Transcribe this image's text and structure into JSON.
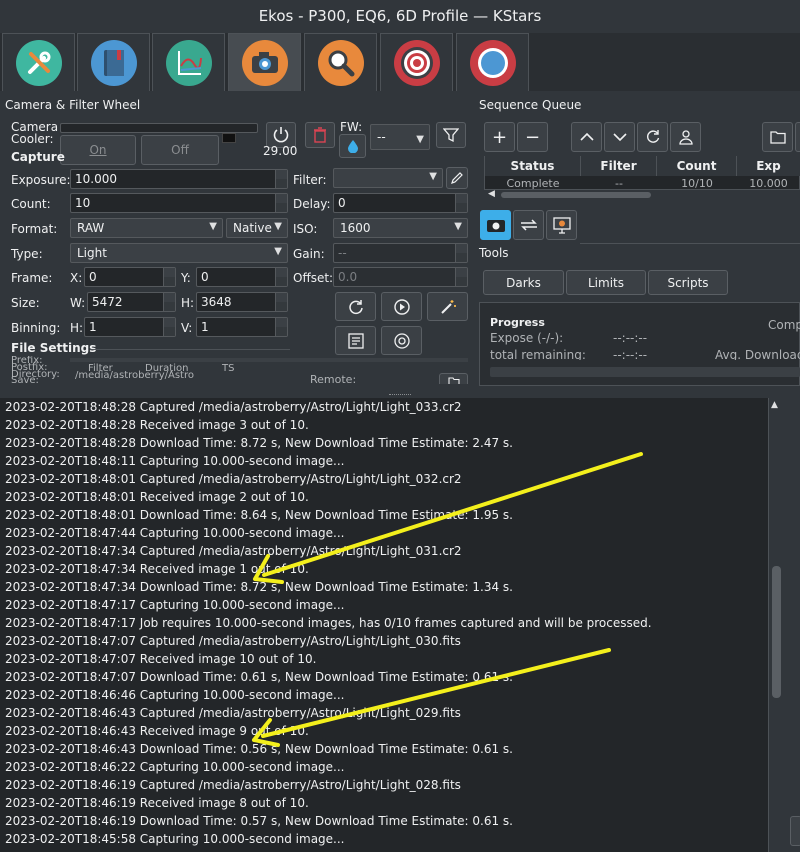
{
  "window": {
    "title": "Ekos - P300, EQ6, 6D Profile — KStars"
  },
  "tabs": [
    {
      "name": "setup-tools-icon",
      "color": "#3fb7a0"
    },
    {
      "name": "scheduler-book-icon",
      "color": "#4c97d3"
    },
    {
      "name": "analyze-chart-icon",
      "color": "#39a88f"
    },
    {
      "name": "capture-camera-icon",
      "color": "#e8893c"
    },
    {
      "name": "focus-magnifier-icon",
      "color": "#e8893c"
    },
    {
      "name": "align-target-icon",
      "color": "#c93d44"
    },
    {
      "name": "guide-compass-icon",
      "color": "#c93d44"
    }
  ],
  "camera": {
    "panel_title": "Camera & Filter Wheel",
    "cooler_label": "Camera\nCooler:",
    "on_label": "On",
    "off_label": "Off",
    "temperature": "29.00",
    "fw_label": "FW:",
    "fw_value": "--",
    "capture_label": "Capture",
    "exposure_label": "Exposure:",
    "exposure_value": "10.000",
    "count_label": "Count:",
    "count_value": "10",
    "format_label": "Format:",
    "format_value": "RAW",
    "native_value": "Native",
    "type_label": "Type:",
    "type_value": "Light",
    "frame_label": "Frame:",
    "x_label": "X:",
    "x_value": "0",
    "y_label": "Y:",
    "y_value": "0",
    "size_label": "Size:",
    "w_label": "W:",
    "w_value": "5472",
    "h_label": "H:",
    "h_value": "3648",
    "binning_label": "Binning:",
    "hbin_label": "H:",
    "hbin_value": "1",
    "vbin_label": "V:",
    "vbin_value": "1",
    "filter_label": "Filter:",
    "filter_value": "",
    "delay_label": "Delay:",
    "delay_value": "0",
    "iso_label": "ISO:",
    "iso_value": "1600",
    "gain_label": "Gain:",
    "gain_value": "--",
    "offset_label": "Offset:",
    "offset_value": "0.0",
    "file_settings_label": "File Settings",
    "prefix_label": "Prefix:",
    "postfix_label": "Postfix:",
    "directory_label": "Directory:",
    "save_label": "Save:",
    "filter_chip": "Filter",
    "duration_chip": "Duration",
    "ts_chip": "TS",
    "directory_value": "/media/astroberry/Astro",
    "remote_label": "Remote:"
  },
  "sequence": {
    "panel_title": "Sequence Queue",
    "columns": [
      "Status",
      "Filter",
      "Count",
      "Exp"
    ],
    "rows": [
      [
        "Complete",
        "--",
        "10/10",
        "10.000"
      ]
    ],
    "tools_label": "Tools",
    "darks_label": "Darks",
    "limits_label": "Limits",
    "scripts_label": "Scripts",
    "progress_label": "Progress",
    "expose_label": "Expose (-/-):",
    "expose_value": "--:--:--",
    "total_label": "total remaining:",
    "total_value": "--:--:--",
    "comp_label": "Comp",
    "avg_download_label": "Avg. Download"
  },
  "log": [
    "2023-02-20T18:48:28 Captured /media/astroberry/Astro/Light/Light_033.cr2",
    "2023-02-20T18:48:28 Received image 3 out of 10.",
    "2023-02-20T18:48:28 Download Time: 8.72 s, New Download Time Estimate: 2.47 s.",
    "2023-02-20T18:48:11 Capturing 10.000-second  image...",
    "2023-02-20T18:48:01 Captured /media/astroberry/Astro/Light/Light_032.cr2",
    "2023-02-20T18:48:01 Received image 2 out of 10.",
    "2023-02-20T18:48:01 Download Time: 8.64 s, New Download Time Estimate: 1.95 s.",
    "2023-02-20T18:47:44 Capturing 10.000-second  image...",
    "2023-02-20T18:47:34 Captured /media/astroberry/Astro/Light/Light_031.cr2",
    "2023-02-20T18:47:34 Received image 1 out of 10.",
    "2023-02-20T18:47:34 Download Time: 8.72 s, New Download Time Estimate: 1.34 s.",
    "2023-02-20T18:47:17 Capturing 10.000-second  image...",
    "2023-02-20T18:47:17 Job requires 10.000-second  images, has 0/10 frames captured and will be processed.",
    "2023-02-20T18:47:07 Captured /media/astroberry/Astro/Light/Light_030.fits",
    "2023-02-20T18:47:07 Received image 10 out of 10.",
    "2023-02-20T18:47:07 Download Time: 0.61 s, New Download Time Estimate: 0.61 s.",
    "2023-02-20T18:46:46 Capturing 10.000-second  image...",
    "2023-02-20T18:46:43 Captured /media/astroberry/Astro/Light/Light_029.fits",
    "2023-02-20T18:46:43 Received image 9 out of 10.",
    "2023-02-20T18:46:43 Download Time: 0.56 s, New Download Time Estimate: 0.61 s.",
    "2023-02-20T18:46:22 Capturing 10.000-second  image...",
    "2023-02-20T18:46:19 Captured /media/astroberry/Astro/Light/Light_028.fits",
    "2023-02-20T18:46:19 Received image 8 out of 10.",
    "2023-02-20T18:46:19 Download Time: 0.57 s, New Download Time Estimate: 0.61 s.",
    "2023-02-20T18:45:58 Capturing 10.000-second  image..."
  ],
  "annotation_color": "#f3ef1c"
}
